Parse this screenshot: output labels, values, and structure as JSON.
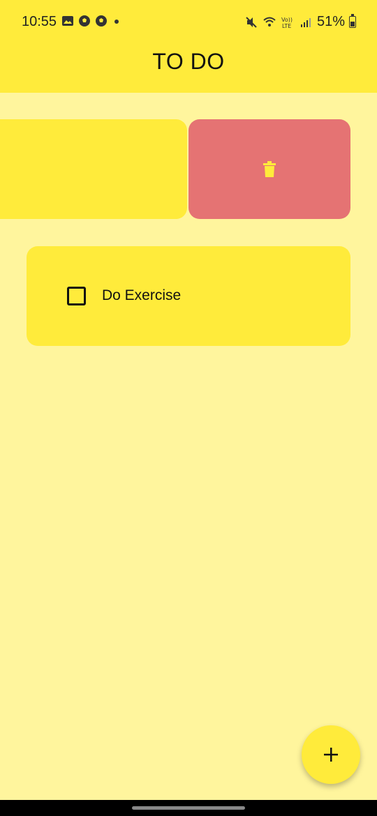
{
  "status_bar": {
    "time": "10:55",
    "left_icons": [
      "image-icon",
      "soccer-ball-icon",
      "soccer-ball-icon"
    ],
    "right_icons": [
      "mute-icon",
      "wifi-icon",
      "volte-icon",
      "signal-icon"
    ],
    "lte_label": "Vo)) LTE",
    "battery": "51%"
  },
  "app_bar": {
    "title": "TO DO"
  },
  "tasks": [
    {
      "label": "Do Exercise",
      "checked": false
    }
  ],
  "swiped_item": {
    "action_icon": "trash-icon"
  },
  "fab": {
    "icon": "plus-icon"
  },
  "colors": {
    "primary": "#FFEB3B",
    "background": "#FFF59D",
    "delete": "#E57373"
  }
}
